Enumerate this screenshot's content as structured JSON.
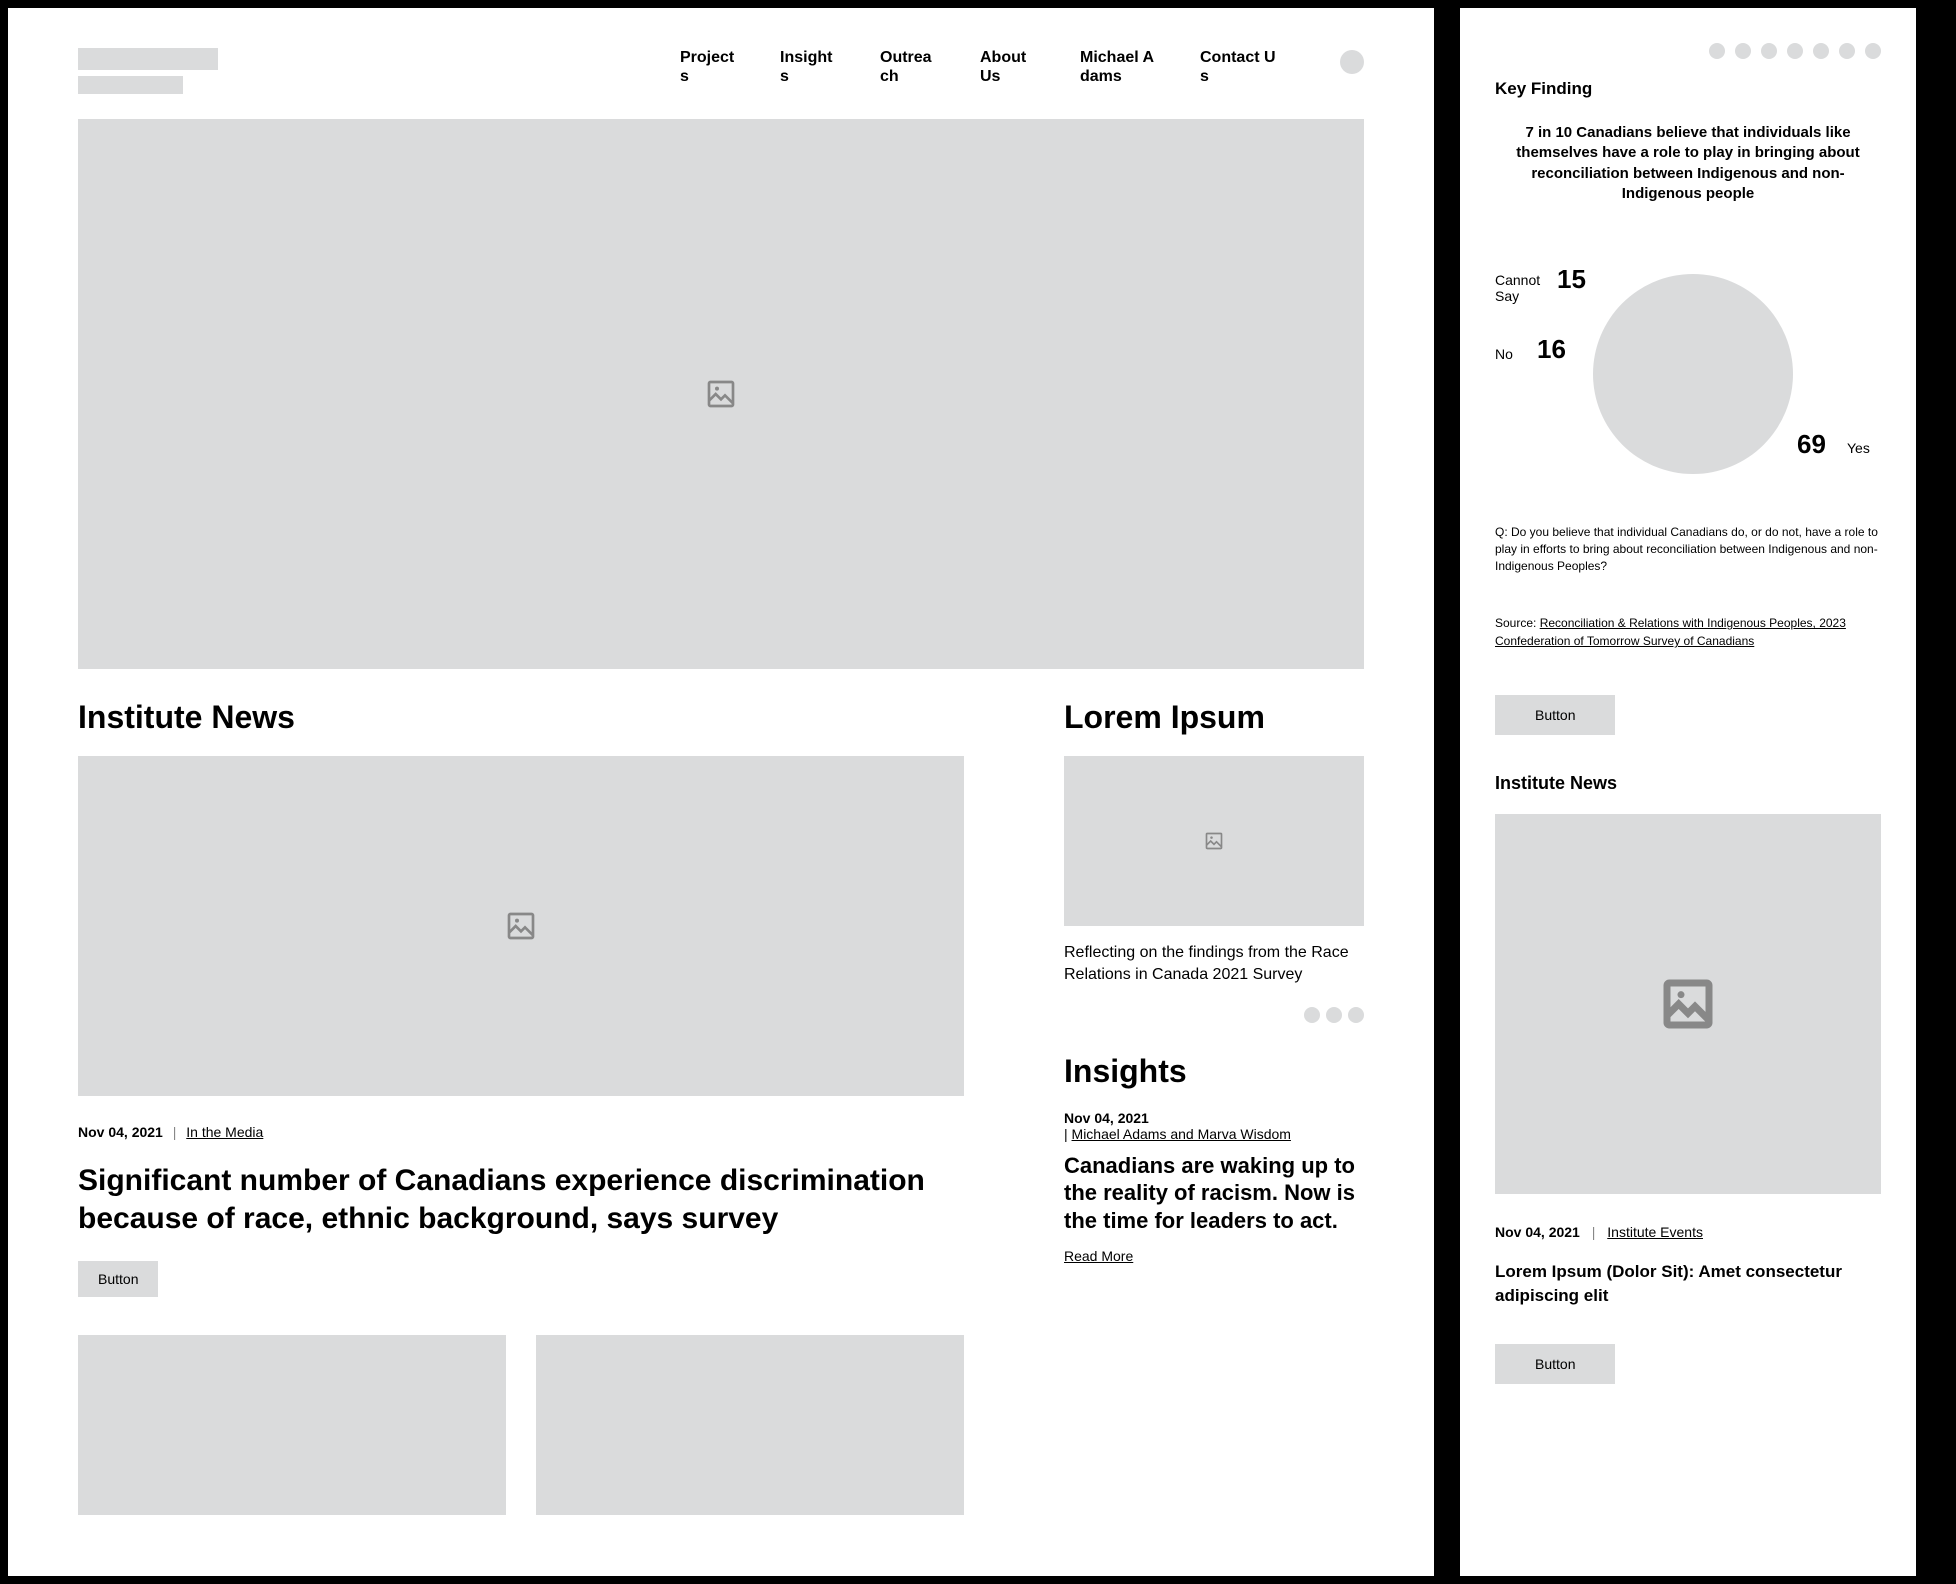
{
  "nav": {
    "items": [
      "Projects",
      "Insights",
      "Outreach",
      "About Us",
      "Michael Adams",
      "Contact Us"
    ]
  },
  "sections": {
    "institute_news": "Institute News",
    "lorem": "Lorem Ipsum",
    "insights": "Insights",
    "key_finding": "Key Finding"
  },
  "news": {
    "date": "Nov 04, 2021",
    "category": "In the Media",
    "headline": "Significant number of Canadians experience discrimination because of race, ethnic background, says survey",
    "button": "Button"
  },
  "side_card": {
    "caption": "Reflecting on the findings from the Race Relations in Canada 2021 Survey"
  },
  "insights": {
    "date": "Nov 04, 2021",
    "sep": "|",
    "authors": "Michael Adams and Marva Wisdom",
    "title": "Canadians are waking up to the reality of racism. Now is the time for leaders to act.",
    "read_more": "Read More"
  },
  "keyfinding": {
    "text": "7 in 10 Canadians believe that individuals like themselves have a role to play in bringing about reconciliation between Indigenous and non-Indigenous people",
    "question": "Q: Do you believe that individual Canadians do, or do not, have a role to play in efforts to bring about reconciliation between Indigenous and non-Indigenous Peoples?",
    "source_label": "Source: ",
    "source_link": "Reconciliation & Relations with Indigenous Peoples, 2023 Confederation of Tomorrow Survey of Canadians",
    "button": "Button"
  },
  "chart_data": {
    "type": "pie",
    "title": "7 in 10 Canadians believe that individuals like themselves have a role to play in bringing about reconciliation between Indigenous and non-Indigenous people",
    "categories": [
      "Cannot Say",
      "No",
      "Yes"
    ],
    "values": [
      15,
      16,
      69
    ]
  },
  "mobile_news": {
    "date": "Nov 04, 2021",
    "category": "Institute Events",
    "headline": "Lorem Ipsum (Dolor Sit): Amet consectetur adipiscing elit",
    "button": "Button"
  }
}
